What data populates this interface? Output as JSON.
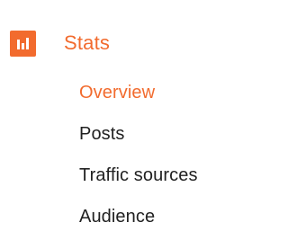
{
  "colors": {
    "accent": "#f26b2e",
    "text": "#212121",
    "icon_fg": "#ffffff"
  },
  "stats_section": {
    "icon": "bar-chart-icon",
    "label": "Stats",
    "items": [
      {
        "label": "Overview",
        "active": true
      },
      {
        "label": "Posts",
        "active": false
      },
      {
        "label": "Traffic sources",
        "active": false
      },
      {
        "label": "Audience",
        "active": false
      }
    ]
  }
}
